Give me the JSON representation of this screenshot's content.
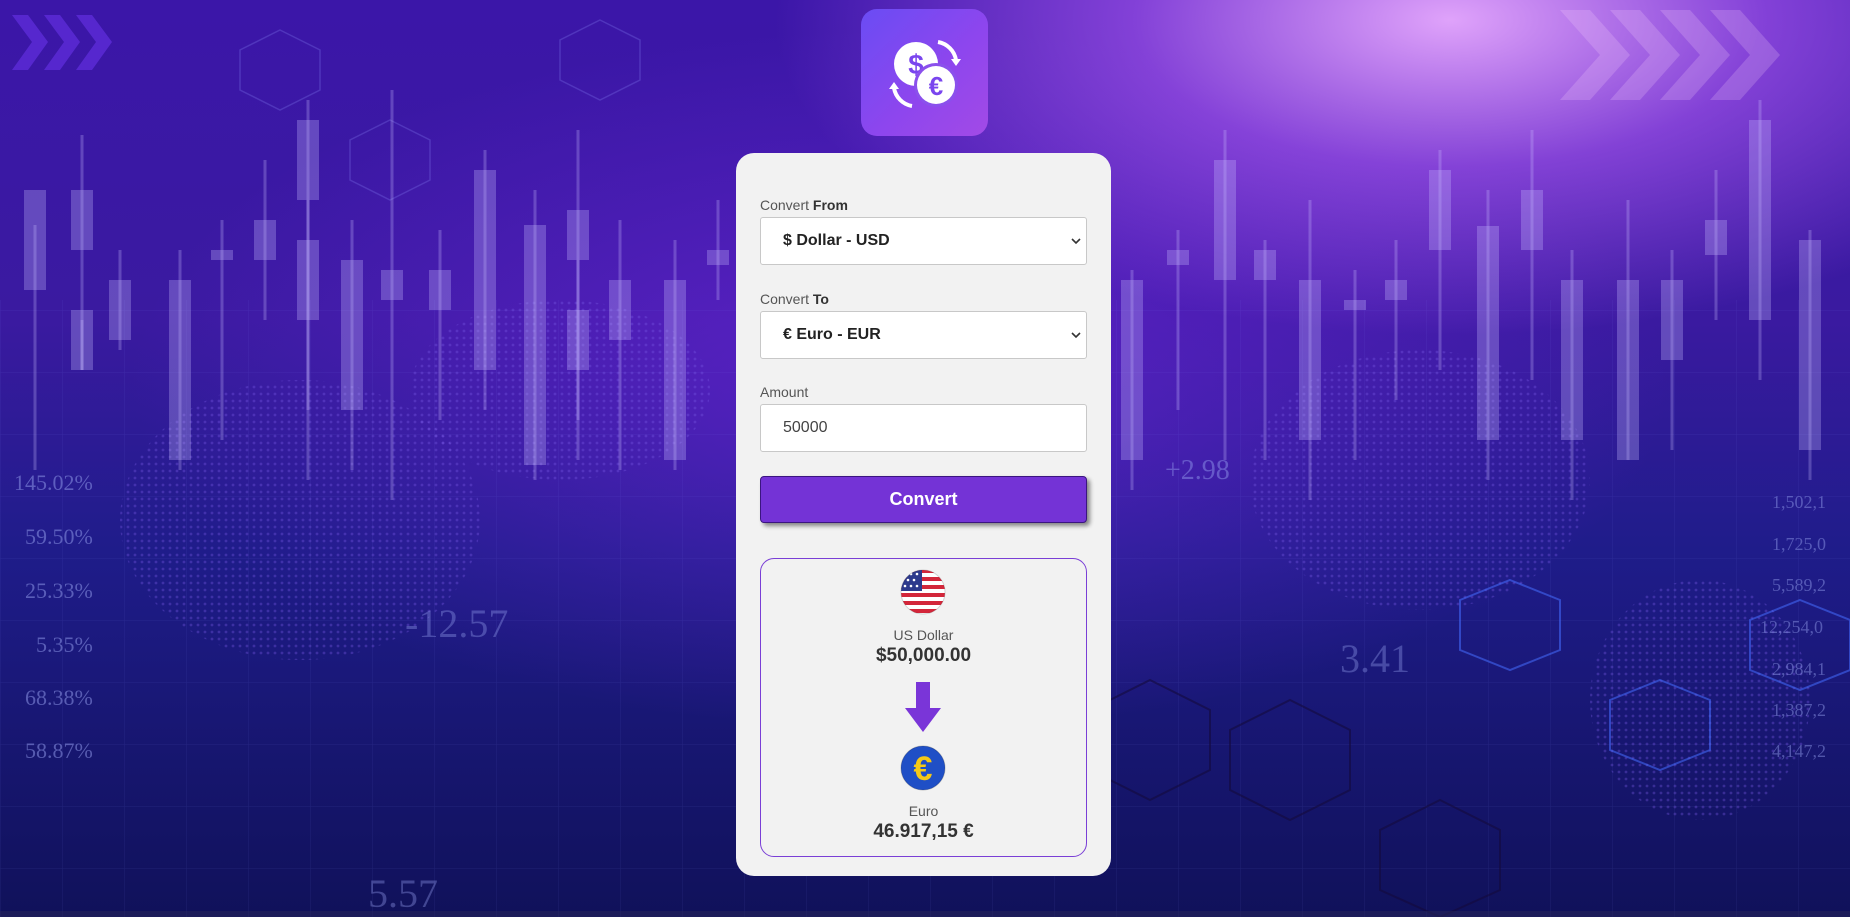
{
  "form": {
    "from_label_prefix": "Convert",
    "from_label_bold": "From",
    "from_value": "$ Dollar - USD",
    "to_label_prefix": "Convert",
    "to_label_bold": "To",
    "to_value": "€ Euro - EUR",
    "amount_label": "Amount",
    "amount_value": "50000",
    "convert_button": "Convert"
  },
  "result": {
    "from_name": "US Dollar",
    "from_amount": "$50,000.00",
    "to_name": "Euro",
    "to_amount": "46.917,15 €"
  },
  "background": {
    "left_percents": [
      "145.02%",
      "59.50%",
      "25.33%",
      "5.35%",
      "68.38%",
      "58.87%"
    ],
    "right_numbers": [
      "1,502,1",
      "1,725,0",
      "5,589,2",
      "12,254,0",
      "2,984,1",
      "1,387,2",
      "4,147,2"
    ],
    "center_numbers": [
      "+2.98",
      "-12.57",
      "3.41",
      "5.57"
    ]
  },
  "colors": {
    "accent": "#7433d6",
    "card": "#f2f2f2",
    "logo_gradient_start": "#6a4cf4",
    "logo_gradient_end": "#a24ae6"
  },
  "icons": {
    "logo": "currency-exchange-icon",
    "from_flag": "us-flag-icon",
    "to_flag": "euro-icon",
    "arrow": "arrow-down-icon"
  }
}
